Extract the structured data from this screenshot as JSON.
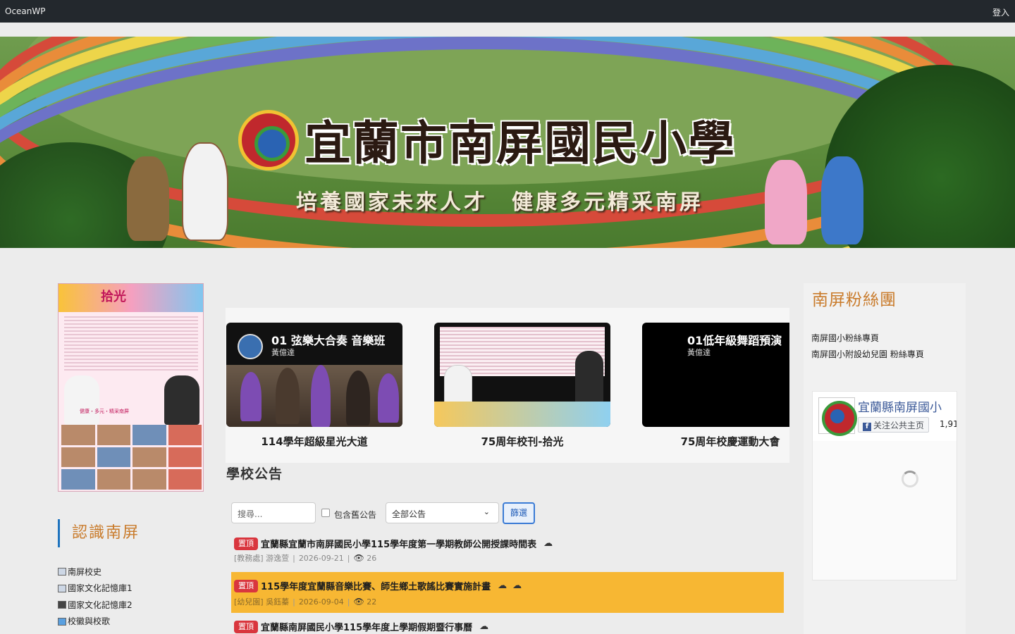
{
  "topbar": {
    "brand": "OceanWP",
    "login": "登入"
  },
  "banner": {
    "school_name": "宜蘭市南屏國民小學",
    "slogan": "培養國家未來人才　健康多元精采南屏"
  },
  "left": {
    "poster": {
      "title": "拾光",
      "tagline": "健康・多元・精采南屏"
    },
    "section_title": "認識南屏",
    "links": [
      {
        "label": "南屏校史",
        "icon": "history-icon"
      },
      {
        "label": "國家文化記憶庫1",
        "icon": "archive-icon"
      },
      {
        "label": "國家文化記憶庫2",
        "icon": "camera-icon"
      },
      {
        "label": "校徽與校歌",
        "icon": "emblem-icon"
      }
    ]
  },
  "carousel": {
    "slides": [
      {
        "overlay_title": "01 弦樂大合奏 音樂班",
        "overlay_author": "黃億達",
        "caption": "114學年超級星光大道"
      },
      {
        "overlay_title": "",
        "overlay_author": "",
        "caption": "75周年校刊-拾光"
      },
      {
        "overlay_title": "01低年級舞蹈預演",
        "overlay_author": "黃億達",
        "caption": "75周年校慶運動大會"
      }
    ]
  },
  "announcements": {
    "heading": "學校公告",
    "search_placeholder": "搜尋...",
    "include_old_label": "包含舊公告",
    "filter_select": "全部公告",
    "filter_button": "篩選",
    "items": [
      {
        "badge": "置頂",
        "title": "宜蘭縣宜蘭市南屏國民小學115學年度第一學期教師公開授課時間表",
        "clouds": 1,
        "dept": "[教務處] 游逸萱",
        "date": "2026-09-21",
        "views": "26",
        "highlight": false
      },
      {
        "badge": "置頂",
        "title": "115學年度宜蘭縣音樂比賽、師生鄉土歌謠比賽實施計畫",
        "clouds": 2,
        "dept": "[幼兒園] 吳鈺蓁",
        "date": "2026-09-04",
        "views": "22",
        "highlight": true
      },
      {
        "badge": "置頂",
        "title": "宜蘭縣南屏國民小學115學年度上學期假期暨行事曆",
        "clouds": 1,
        "dept": "",
        "date": "",
        "views": "",
        "highlight": false
      }
    ]
  },
  "right": {
    "fans_title": "南屏粉絲團",
    "fan_links": [
      "南屏國小粉絲專頁",
      "南屏國小附設幼兒園 粉絲專頁"
    ],
    "fb": {
      "name": "宜蘭縣南屏國小",
      "follow": "关注公共主页",
      "count": "1,91"
    }
  },
  "colors": {
    "accent_orange": "#c97b2b",
    "badge_red": "#d9363e",
    "highlight": "#f7b733",
    "topbar": "#23282d"
  }
}
